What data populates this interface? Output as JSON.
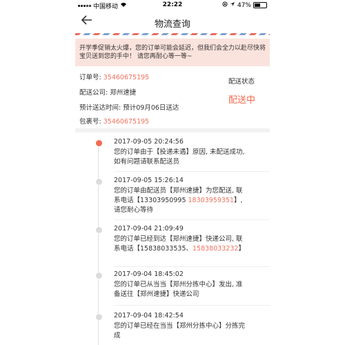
{
  "status_bar": {
    "carrier": "中国移动",
    "time": "22:22",
    "battery_percent": "47%",
    "battery_level": 0.47
  },
  "nav": {
    "title": "物流查询"
  },
  "notice": {
    "text": "开学季促销太火爆，您的订单可能会延迟，但我们会全力以赴尽快将宝贝送到您的手中！ 请您再耐心等一等~"
  },
  "order": {
    "order_no_label": "订单号: ",
    "order_no": "35460675195",
    "company_label": "配送公司: ",
    "company": "郑州速捷",
    "eta_label": "预计送达时间: ",
    "eta": "预计09月06日送达",
    "package_label": "包裹号: ",
    "package_no": "35460675195",
    "status_label": "配送状态",
    "status_value": "配送中"
  },
  "timeline": [
    {
      "time": "2017-09-05 20:24:56",
      "text": "您的订单由于【投递未遇】原因, 未配送成功, 如有问题请联系配送员",
      "phone": "",
      "text_after": ""
    },
    {
      "time": "2017-09-05 15:26:14",
      "text": "您的订单由配送员【郑州速捷】为您配送, 联系电话【13303950995 ",
      "phone": "18303959351",
      "text_after": "】, 请您耐心等待"
    },
    {
      "time": "2017-09-04 21:09:49",
      "text": "您的订单已经到达【郑州速捷】快递公司, 联系电话【15838033535、",
      "phone": "15838033232",
      "text_after": "】"
    },
    {
      "time": "2017-09-04 18:45:02",
      "text": "您的订单已从当当【郑州分拣中心】发出, 准备送往【郑州速捷】快递公司",
      "phone": "",
      "text_after": ""
    },
    {
      "time": "2017-09-04 18:42:54",
      "text": "您的订单已经在当当【郑州分拣中心】分拣完成",
      "phone": "",
      "text_after": ""
    }
  ]
}
